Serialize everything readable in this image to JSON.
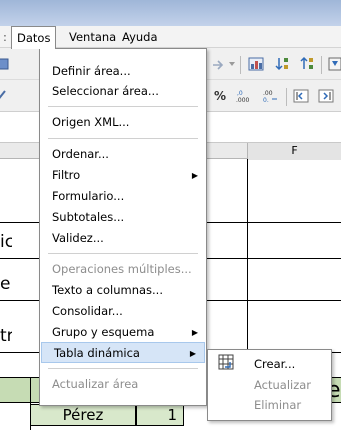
{
  "menubar": {
    "separator": ":",
    "items": [
      {
        "label": "Datos",
        "key": "D"
      },
      {
        "label": "Ventana",
        "key": "n"
      },
      {
        "label": "Ayuda",
        "key": "u"
      }
    ]
  },
  "toolbar": {
    "decimal_add": ",0\n.000",
    "decimal_remove": ".00\n0.←"
  },
  "sheet": {
    "column_header": "F",
    "row_clip_labels": [
      "ic",
      "e",
      "tr"
    ],
    "cells": {
      "perez": "Pérez",
      "one": "1",
      "e": "e"
    },
    "colors": {
      "green_row": "#c6dcb4",
      "cell_fill": "#d8e8cb"
    }
  },
  "data_menu": {
    "items": [
      {
        "label": "Definir área...",
        "enabled": true
      },
      {
        "label": "Seleccionar área...",
        "enabled": true
      },
      {
        "label": "Origen XML...",
        "enabled": true
      },
      {
        "label": "Ordenar...",
        "enabled": true
      },
      {
        "label": "Filtro",
        "enabled": true,
        "submenu": true
      },
      {
        "label": "Formulario...",
        "enabled": true
      },
      {
        "label": "Subtotales...",
        "enabled": true
      },
      {
        "label": "Validez...",
        "enabled": true
      },
      {
        "label": "Operaciones múltiples...",
        "enabled": false
      },
      {
        "label": "Texto a columnas...",
        "enabled": true
      },
      {
        "label": "Consolidar...",
        "enabled": true
      },
      {
        "label": "Grupo y esquema",
        "enabled": true,
        "submenu": true
      },
      {
        "label": "Tabla dinámica",
        "enabled": true,
        "submenu": true,
        "highlighted": true
      },
      {
        "label": "Actualizar área",
        "enabled": false
      }
    ],
    "submenu_arrow": "▶"
  },
  "pivot_submenu": {
    "icon": "pivot-table-icon",
    "items": [
      {
        "label": "Crear...",
        "enabled": true
      },
      {
        "label": "Actualizar",
        "enabled": false
      },
      {
        "label": "Eliminar",
        "enabled": false
      }
    ]
  }
}
